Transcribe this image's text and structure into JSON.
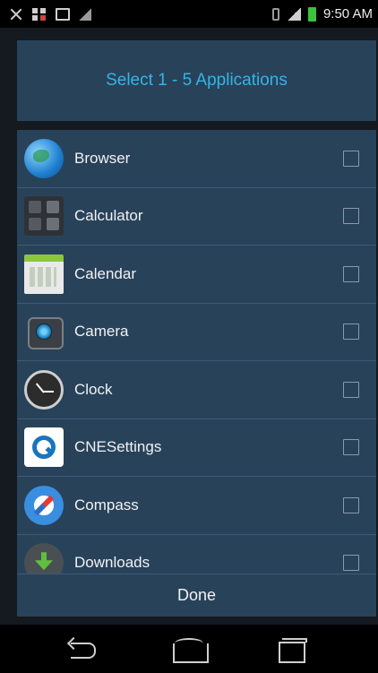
{
  "status_bar": {
    "time": "9:50 AM",
    "icons": [
      "mute-icon",
      "grid-icon",
      "image-icon",
      "signal-icon",
      "vibrate-icon",
      "cell-signal-icon",
      "battery-icon"
    ],
    "battery_color": "#3bc43b"
  },
  "dialog": {
    "title": "Select 1 - 5 Applications",
    "title_color": "#33b5e5",
    "background": "#28425a"
  },
  "apps": [
    {
      "label": "Browser",
      "icon": "browser-icon",
      "checked": false
    },
    {
      "label": "Calculator",
      "icon": "calculator-icon",
      "checked": false
    },
    {
      "label": "Calendar",
      "icon": "calendar-icon",
      "checked": false
    },
    {
      "label": "Camera",
      "icon": "camera-icon",
      "checked": false
    },
    {
      "label": "Clock",
      "icon": "clock-icon",
      "checked": false
    },
    {
      "label": "CNESettings",
      "icon": "cnesettings-icon",
      "checked": false
    },
    {
      "label": "Compass",
      "icon": "compass-icon",
      "checked": false
    },
    {
      "label": "Downloads",
      "icon": "downloads-icon",
      "checked": false
    }
  ],
  "footer": {
    "done_label": "Done"
  },
  "nav_bar": {
    "buttons": [
      "back-icon",
      "home-icon",
      "recent-apps-icon"
    ]
  }
}
